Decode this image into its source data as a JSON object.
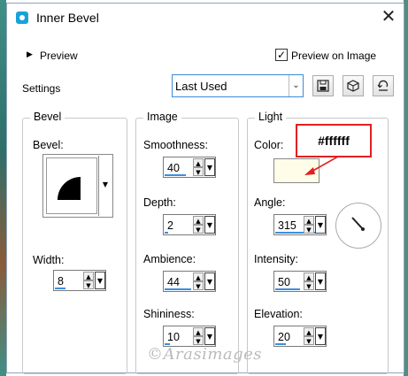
{
  "window": {
    "title": "Inner Bevel"
  },
  "preview": {
    "label": "Preview",
    "on_image_label": "Preview on Image",
    "on_image_checked": true
  },
  "settings": {
    "label": "Settings",
    "preset_value": "Last Used"
  },
  "bevel": {
    "group_title": "Bevel",
    "bevel_label": "Bevel:",
    "width_label": "Width:",
    "width_value": "8"
  },
  "image": {
    "group_title": "Image",
    "smoothness_label": "Smoothness:",
    "smoothness_value": "40",
    "depth_label": "Depth:",
    "depth_value": "2",
    "ambience_label": "Ambience:",
    "ambience_value": "44",
    "shininess_label": "Shininess:",
    "shininess_value": "10"
  },
  "light": {
    "group_title": "Light",
    "color_label": "Color:",
    "color_value": "#fffde8",
    "angle_label": "Angle:",
    "angle_value": "315",
    "intensity_label": "Intensity:",
    "intensity_value": "50",
    "elevation_label": "Elevation:",
    "elevation_value": "20"
  },
  "annotation": {
    "hex_text": "#ffffff",
    "color": "#e02020"
  },
  "watermark": {
    "text": "©Arasimages"
  },
  "icons": [
    "app-icon",
    "close-icon",
    "expand-triangle-icon",
    "checkmark-icon",
    "chevron-down-icon",
    "save-icon",
    "randomize-dice-icon",
    "reset-icon",
    "up-arrow-icon",
    "down-arrow-icon"
  ]
}
